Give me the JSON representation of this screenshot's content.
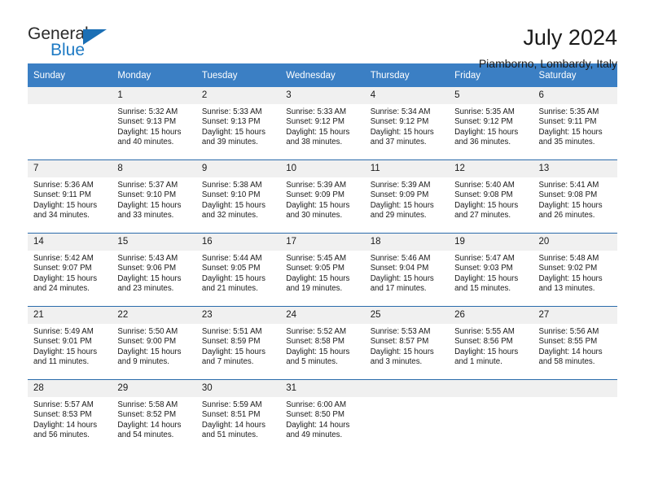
{
  "brand": {
    "name_part1": "General",
    "name_part2": "Blue",
    "triangle_color": "#1b6fb5"
  },
  "header": {
    "title": "July 2024",
    "subtitle": "Piamborno, Lombardy, Italy"
  },
  "theme": {
    "header_row_bg": "#3b7fc4",
    "week_rule": "#2a6bab",
    "daynum_bg": "#f0f0f0",
    "brand_blue": "#1e7ac4"
  },
  "weekdays": [
    "Sunday",
    "Monday",
    "Tuesday",
    "Wednesday",
    "Thursday",
    "Friday",
    "Saturday"
  ],
  "weeks": [
    [
      {
        "day": "",
        "sunrise": "",
        "sunset": "",
        "daylight1": "",
        "daylight2": ""
      },
      {
        "day": "1",
        "sunrise": "Sunrise: 5:32 AM",
        "sunset": "Sunset: 9:13 PM",
        "daylight1": "Daylight: 15 hours",
        "daylight2": "and 40 minutes."
      },
      {
        "day": "2",
        "sunrise": "Sunrise: 5:33 AM",
        "sunset": "Sunset: 9:13 PM",
        "daylight1": "Daylight: 15 hours",
        "daylight2": "and 39 minutes."
      },
      {
        "day": "3",
        "sunrise": "Sunrise: 5:33 AM",
        "sunset": "Sunset: 9:12 PM",
        "daylight1": "Daylight: 15 hours",
        "daylight2": "and 38 minutes."
      },
      {
        "day": "4",
        "sunrise": "Sunrise: 5:34 AM",
        "sunset": "Sunset: 9:12 PM",
        "daylight1": "Daylight: 15 hours",
        "daylight2": "and 37 minutes."
      },
      {
        "day": "5",
        "sunrise": "Sunrise: 5:35 AM",
        "sunset": "Sunset: 9:12 PM",
        "daylight1": "Daylight: 15 hours",
        "daylight2": "and 36 minutes."
      },
      {
        "day": "6",
        "sunrise": "Sunrise: 5:35 AM",
        "sunset": "Sunset: 9:11 PM",
        "daylight1": "Daylight: 15 hours",
        "daylight2": "and 35 minutes."
      }
    ],
    [
      {
        "day": "7",
        "sunrise": "Sunrise: 5:36 AM",
        "sunset": "Sunset: 9:11 PM",
        "daylight1": "Daylight: 15 hours",
        "daylight2": "and 34 minutes."
      },
      {
        "day": "8",
        "sunrise": "Sunrise: 5:37 AM",
        "sunset": "Sunset: 9:10 PM",
        "daylight1": "Daylight: 15 hours",
        "daylight2": "and 33 minutes."
      },
      {
        "day": "9",
        "sunrise": "Sunrise: 5:38 AM",
        "sunset": "Sunset: 9:10 PM",
        "daylight1": "Daylight: 15 hours",
        "daylight2": "and 32 minutes."
      },
      {
        "day": "10",
        "sunrise": "Sunrise: 5:39 AM",
        "sunset": "Sunset: 9:09 PM",
        "daylight1": "Daylight: 15 hours",
        "daylight2": "and 30 minutes."
      },
      {
        "day": "11",
        "sunrise": "Sunrise: 5:39 AM",
        "sunset": "Sunset: 9:09 PM",
        "daylight1": "Daylight: 15 hours",
        "daylight2": "and 29 minutes."
      },
      {
        "day": "12",
        "sunrise": "Sunrise: 5:40 AM",
        "sunset": "Sunset: 9:08 PM",
        "daylight1": "Daylight: 15 hours",
        "daylight2": "and 27 minutes."
      },
      {
        "day": "13",
        "sunrise": "Sunrise: 5:41 AM",
        "sunset": "Sunset: 9:08 PM",
        "daylight1": "Daylight: 15 hours",
        "daylight2": "and 26 minutes."
      }
    ],
    [
      {
        "day": "14",
        "sunrise": "Sunrise: 5:42 AM",
        "sunset": "Sunset: 9:07 PM",
        "daylight1": "Daylight: 15 hours",
        "daylight2": "and 24 minutes."
      },
      {
        "day": "15",
        "sunrise": "Sunrise: 5:43 AM",
        "sunset": "Sunset: 9:06 PM",
        "daylight1": "Daylight: 15 hours",
        "daylight2": "and 23 minutes."
      },
      {
        "day": "16",
        "sunrise": "Sunrise: 5:44 AM",
        "sunset": "Sunset: 9:05 PM",
        "daylight1": "Daylight: 15 hours",
        "daylight2": "and 21 minutes."
      },
      {
        "day": "17",
        "sunrise": "Sunrise: 5:45 AM",
        "sunset": "Sunset: 9:05 PM",
        "daylight1": "Daylight: 15 hours",
        "daylight2": "and 19 minutes."
      },
      {
        "day": "18",
        "sunrise": "Sunrise: 5:46 AM",
        "sunset": "Sunset: 9:04 PM",
        "daylight1": "Daylight: 15 hours",
        "daylight2": "and 17 minutes."
      },
      {
        "day": "19",
        "sunrise": "Sunrise: 5:47 AM",
        "sunset": "Sunset: 9:03 PM",
        "daylight1": "Daylight: 15 hours",
        "daylight2": "and 15 minutes."
      },
      {
        "day": "20",
        "sunrise": "Sunrise: 5:48 AM",
        "sunset": "Sunset: 9:02 PM",
        "daylight1": "Daylight: 15 hours",
        "daylight2": "and 13 minutes."
      }
    ],
    [
      {
        "day": "21",
        "sunrise": "Sunrise: 5:49 AM",
        "sunset": "Sunset: 9:01 PM",
        "daylight1": "Daylight: 15 hours",
        "daylight2": "and 11 minutes."
      },
      {
        "day": "22",
        "sunrise": "Sunrise: 5:50 AM",
        "sunset": "Sunset: 9:00 PM",
        "daylight1": "Daylight: 15 hours",
        "daylight2": "and 9 minutes."
      },
      {
        "day": "23",
        "sunrise": "Sunrise: 5:51 AM",
        "sunset": "Sunset: 8:59 PM",
        "daylight1": "Daylight: 15 hours",
        "daylight2": "and 7 minutes."
      },
      {
        "day": "24",
        "sunrise": "Sunrise: 5:52 AM",
        "sunset": "Sunset: 8:58 PM",
        "daylight1": "Daylight: 15 hours",
        "daylight2": "and 5 minutes."
      },
      {
        "day": "25",
        "sunrise": "Sunrise: 5:53 AM",
        "sunset": "Sunset: 8:57 PM",
        "daylight1": "Daylight: 15 hours",
        "daylight2": "and 3 minutes."
      },
      {
        "day": "26",
        "sunrise": "Sunrise: 5:55 AM",
        "sunset": "Sunset: 8:56 PM",
        "daylight1": "Daylight: 15 hours",
        "daylight2": "and 1 minute."
      },
      {
        "day": "27",
        "sunrise": "Sunrise: 5:56 AM",
        "sunset": "Sunset: 8:55 PM",
        "daylight1": "Daylight: 14 hours",
        "daylight2": "and 58 minutes."
      }
    ],
    [
      {
        "day": "28",
        "sunrise": "Sunrise: 5:57 AM",
        "sunset": "Sunset: 8:53 PM",
        "daylight1": "Daylight: 14 hours",
        "daylight2": "and 56 minutes."
      },
      {
        "day": "29",
        "sunrise": "Sunrise: 5:58 AM",
        "sunset": "Sunset: 8:52 PM",
        "daylight1": "Daylight: 14 hours",
        "daylight2": "and 54 minutes."
      },
      {
        "day": "30",
        "sunrise": "Sunrise: 5:59 AM",
        "sunset": "Sunset: 8:51 PM",
        "daylight1": "Daylight: 14 hours",
        "daylight2": "and 51 minutes."
      },
      {
        "day": "31",
        "sunrise": "Sunrise: 6:00 AM",
        "sunset": "Sunset: 8:50 PM",
        "daylight1": "Daylight: 14 hours",
        "daylight2": "and 49 minutes."
      },
      {
        "day": "",
        "sunrise": "",
        "sunset": "",
        "daylight1": "",
        "daylight2": ""
      },
      {
        "day": "",
        "sunrise": "",
        "sunset": "",
        "daylight1": "",
        "daylight2": ""
      },
      {
        "day": "",
        "sunrise": "",
        "sunset": "",
        "daylight1": "",
        "daylight2": ""
      }
    ]
  ]
}
